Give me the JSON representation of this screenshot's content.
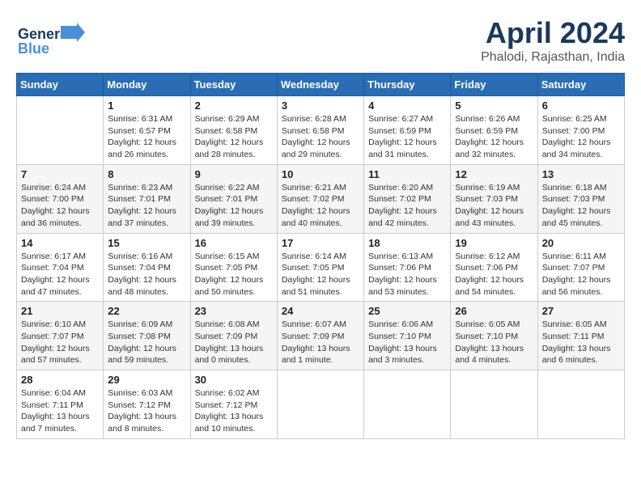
{
  "header": {
    "logo_general": "General",
    "logo_blue": "Blue",
    "title": "April 2024",
    "location": "Phalodi, Rajasthan, India"
  },
  "calendar": {
    "headers": [
      "Sunday",
      "Monday",
      "Tuesday",
      "Wednesday",
      "Thursday",
      "Friday",
      "Saturday"
    ],
    "weeks": [
      [
        {
          "day": "",
          "sunrise": "",
          "sunset": "",
          "daylight": ""
        },
        {
          "day": "1",
          "sunrise": "Sunrise: 6:31 AM",
          "sunset": "Sunset: 6:57 PM",
          "daylight": "Daylight: 12 hours and 26 minutes."
        },
        {
          "day": "2",
          "sunrise": "Sunrise: 6:29 AM",
          "sunset": "Sunset: 6:58 PM",
          "daylight": "Daylight: 12 hours and 28 minutes."
        },
        {
          "day": "3",
          "sunrise": "Sunrise: 6:28 AM",
          "sunset": "Sunset: 6:58 PM",
          "daylight": "Daylight: 12 hours and 29 minutes."
        },
        {
          "day": "4",
          "sunrise": "Sunrise: 6:27 AM",
          "sunset": "Sunset: 6:59 PM",
          "daylight": "Daylight: 12 hours and 31 minutes."
        },
        {
          "day": "5",
          "sunrise": "Sunrise: 6:26 AM",
          "sunset": "Sunset: 6:59 PM",
          "daylight": "Daylight: 12 hours and 32 minutes."
        },
        {
          "day": "6",
          "sunrise": "Sunrise: 6:25 AM",
          "sunset": "Sunset: 7:00 PM",
          "daylight": "Daylight: 12 hours and 34 minutes."
        }
      ],
      [
        {
          "day": "7",
          "sunrise": "Sunrise: 6:24 AM",
          "sunset": "Sunset: 7:00 PM",
          "daylight": "Daylight: 12 hours and 36 minutes."
        },
        {
          "day": "8",
          "sunrise": "Sunrise: 6:23 AM",
          "sunset": "Sunset: 7:01 PM",
          "daylight": "Daylight: 12 hours and 37 minutes."
        },
        {
          "day": "9",
          "sunrise": "Sunrise: 6:22 AM",
          "sunset": "Sunset: 7:01 PM",
          "daylight": "Daylight: 12 hours and 39 minutes."
        },
        {
          "day": "10",
          "sunrise": "Sunrise: 6:21 AM",
          "sunset": "Sunset: 7:02 PM",
          "daylight": "Daylight: 12 hours and 40 minutes."
        },
        {
          "day": "11",
          "sunrise": "Sunrise: 6:20 AM",
          "sunset": "Sunset: 7:02 PM",
          "daylight": "Daylight: 12 hours and 42 minutes."
        },
        {
          "day": "12",
          "sunrise": "Sunrise: 6:19 AM",
          "sunset": "Sunset: 7:03 PM",
          "daylight": "Daylight: 12 hours and 43 minutes."
        },
        {
          "day": "13",
          "sunrise": "Sunrise: 6:18 AM",
          "sunset": "Sunset: 7:03 PM",
          "daylight": "Daylight: 12 hours and 45 minutes."
        }
      ],
      [
        {
          "day": "14",
          "sunrise": "Sunrise: 6:17 AM",
          "sunset": "Sunset: 7:04 PM",
          "daylight": "Daylight: 12 hours and 47 minutes."
        },
        {
          "day": "15",
          "sunrise": "Sunrise: 6:16 AM",
          "sunset": "Sunset: 7:04 PM",
          "daylight": "Daylight: 12 hours and 48 minutes."
        },
        {
          "day": "16",
          "sunrise": "Sunrise: 6:15 AM",
          "sunset": "Sunset: 7:05 PM",
          "daylight": "Daylight: 12 hours and 50 minutes."
        },
        {
          "day": "17",
          "sunrise": "Sunrise: 6:14 AM",
          "sunset": "Sunset: 7:05 PM",
          "daylight": "Daylight: 12 hours and 51 minutes."
        },
        {
          "day": "18",
          "sunrise": "Sunrise: 6:13 AM",
          "sunset": "Sunset: 7:06 PM",
          "daylight": "Daylight: 12 hours and 53 minutes."
        },
        {
          "day": "19",
          "sunrise": "Sunrise: 6:12 AM",
          "sunset": "Sunset: 7:06 PM",
          "daylight": "Daylight: 12 hours and 54 minutes."
        },
        {
          "day": "20",
          "sunrise": "Sunrise: 6:11 AM",
          "sunset": "Sunset: 7:07 PM",
          "daylight": "Daylight: 12 hours and 56 minutes."
        }
      ],
      [
        {
          "day": "21",
          "sunrise": "Sunrise: 6:10 AM",
          "sunset": "Sunset: 7:07 PM",
          "daylight": "Daylight: 12 hours and 57 minutes."
        },
        {
          "day": "22",
          "sunrise": "Sunrise: 6:09 AM",
          "sunset": "Sunset: 7:08 PM",
          "daylight": "Daylight: 12 hours and 59 minutes."
        },
        {
          "day": "23",
          "sunrise": "Sunrise: 6:08 AM",
          "sunset": "Sunset: 7:09 PM",
          "daylight": "Daylight: 13 hours and 0 minutes."
        },
        {
          "day": "24",
          "sunrise": "Sunrise: 6:07 AM",
          "sunset": "Sunset: 7:09 PM",
          "daylight": "Daylight: 13 hours and 1 minute."
        },
        {
          "day": "25",
          "sunrise": "Sunrise: 6:06 AM",
          "sunset": "Sunset: 7:10 PM",
          "daylight": "Daylight: 13 hours and 3 minutes."
        },
        {
          "day": "26",
          "sunrise": "Sunrise: 6:05 AM",
          "sunset": "Sunset: 7:10 PM",
          "daylight": "Daylight: 13 hours and 4 minutes."
        },
        {
          "day": "27",
          "sunrise": "Sunrise: 6:05 AM",
          "sunset": "Sunset: 7:11 PM",
          "daylight": "Daylight: 13 hours and 6 minutes."
        }
      ],
      [
        {
          "day": "28",
          "sunrise": "Sunrise: 6:04 AM",
          "sunset": "Sunset: 7:11 PM",
          "daylight": "Daylight: 13 hours and 7 minutes."
        },
        {
          "day": "29",
          "sunrise": "Sunrise: 6:03 AM",
          "sunset": "Sunset: 7:12 PM",
          "daylight": "Daylight: 13 hours and 8 minutes."
        },
        {
          "day": "30",
          "sunrise": "Sunrise: 6:02 AM",
          "sunset": "Sunset: 7:12 PM",
          "daylight": "Daylight: 13 hours and 10 minutes."
        },
        {
          "day": "",
          "sunrise": "",
          "sunset": "",
          "daylight": ""
        },
        {
          "day": "",
          "sunrise": "",
          "sunset": "",
          "daylight": ""
        },
        {
          "day": "",
          "sunrise": "",
          "sunset": "",
          "daylight": ""
        },
        {
          "day": "",
          "sunrise": "",
          "sunset": "",
          "daylight": ""
        }
      ]
    ]
  }
}
